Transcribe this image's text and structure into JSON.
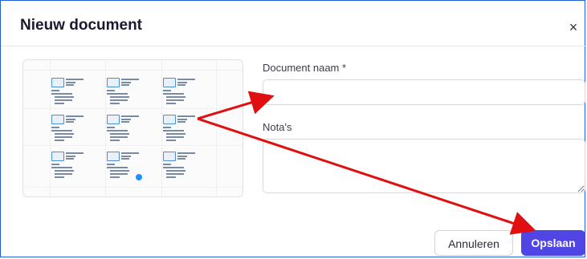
{
  "dialog": {
    "title": "Nieuw document",
    "close_icon": "close-icon"
  },
  "form": {
    "name_label": "Document naam *",
    "name_value": "",
    "notes_label": "Nota's",
    "notes_value": ""
  },
  "buttons": {
    "cancel_label": "Annuleren",
    "save_label": "Opslaan"
  },
  "colors": {
    "primary": "#5046e5",
    "annotation_arrow": "#e01010",
    "frame_border": "#1f5fd6"
  }
}
